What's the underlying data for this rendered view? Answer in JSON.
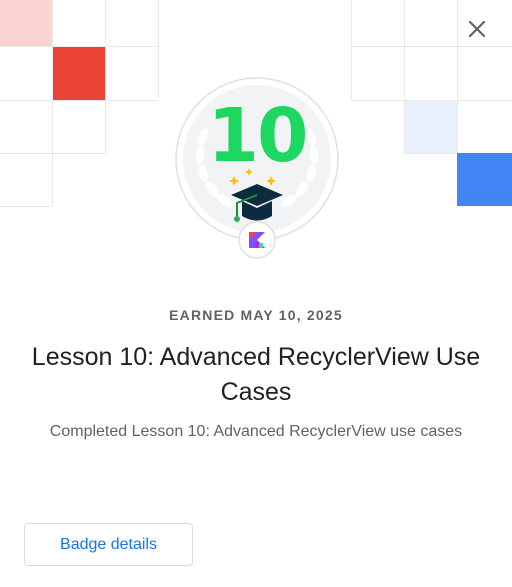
{
  "badge": {
    "number": "10",
    "earned_text": "EARNED MAY 10, 2025",
    "title": "Lesson 10: Advanced RecyclerView Use Cases",
    "description": "Completed Lesson 10: Advanced RecyclerView use cases"
  },
  "actions": {
    "details_label": "Badge details"
  },
  "icons": {
    "close": "close-icon",
    "cap": "graduation-cap-icon",
    "laurel": "laurel-wreath-icon",
    "kotlin": "kotlin-logo-icon"
  },
  "colors": {
    "number_green": "#1ed760",
    "accent_red": "#ea4335",
    "accent_pink": "#fad2cf",
    "accent_blue": "#4285f4",
    "accent_light_blue": "#e8f0fe",
    "link_blue": "#1a73e8"
  }
}
